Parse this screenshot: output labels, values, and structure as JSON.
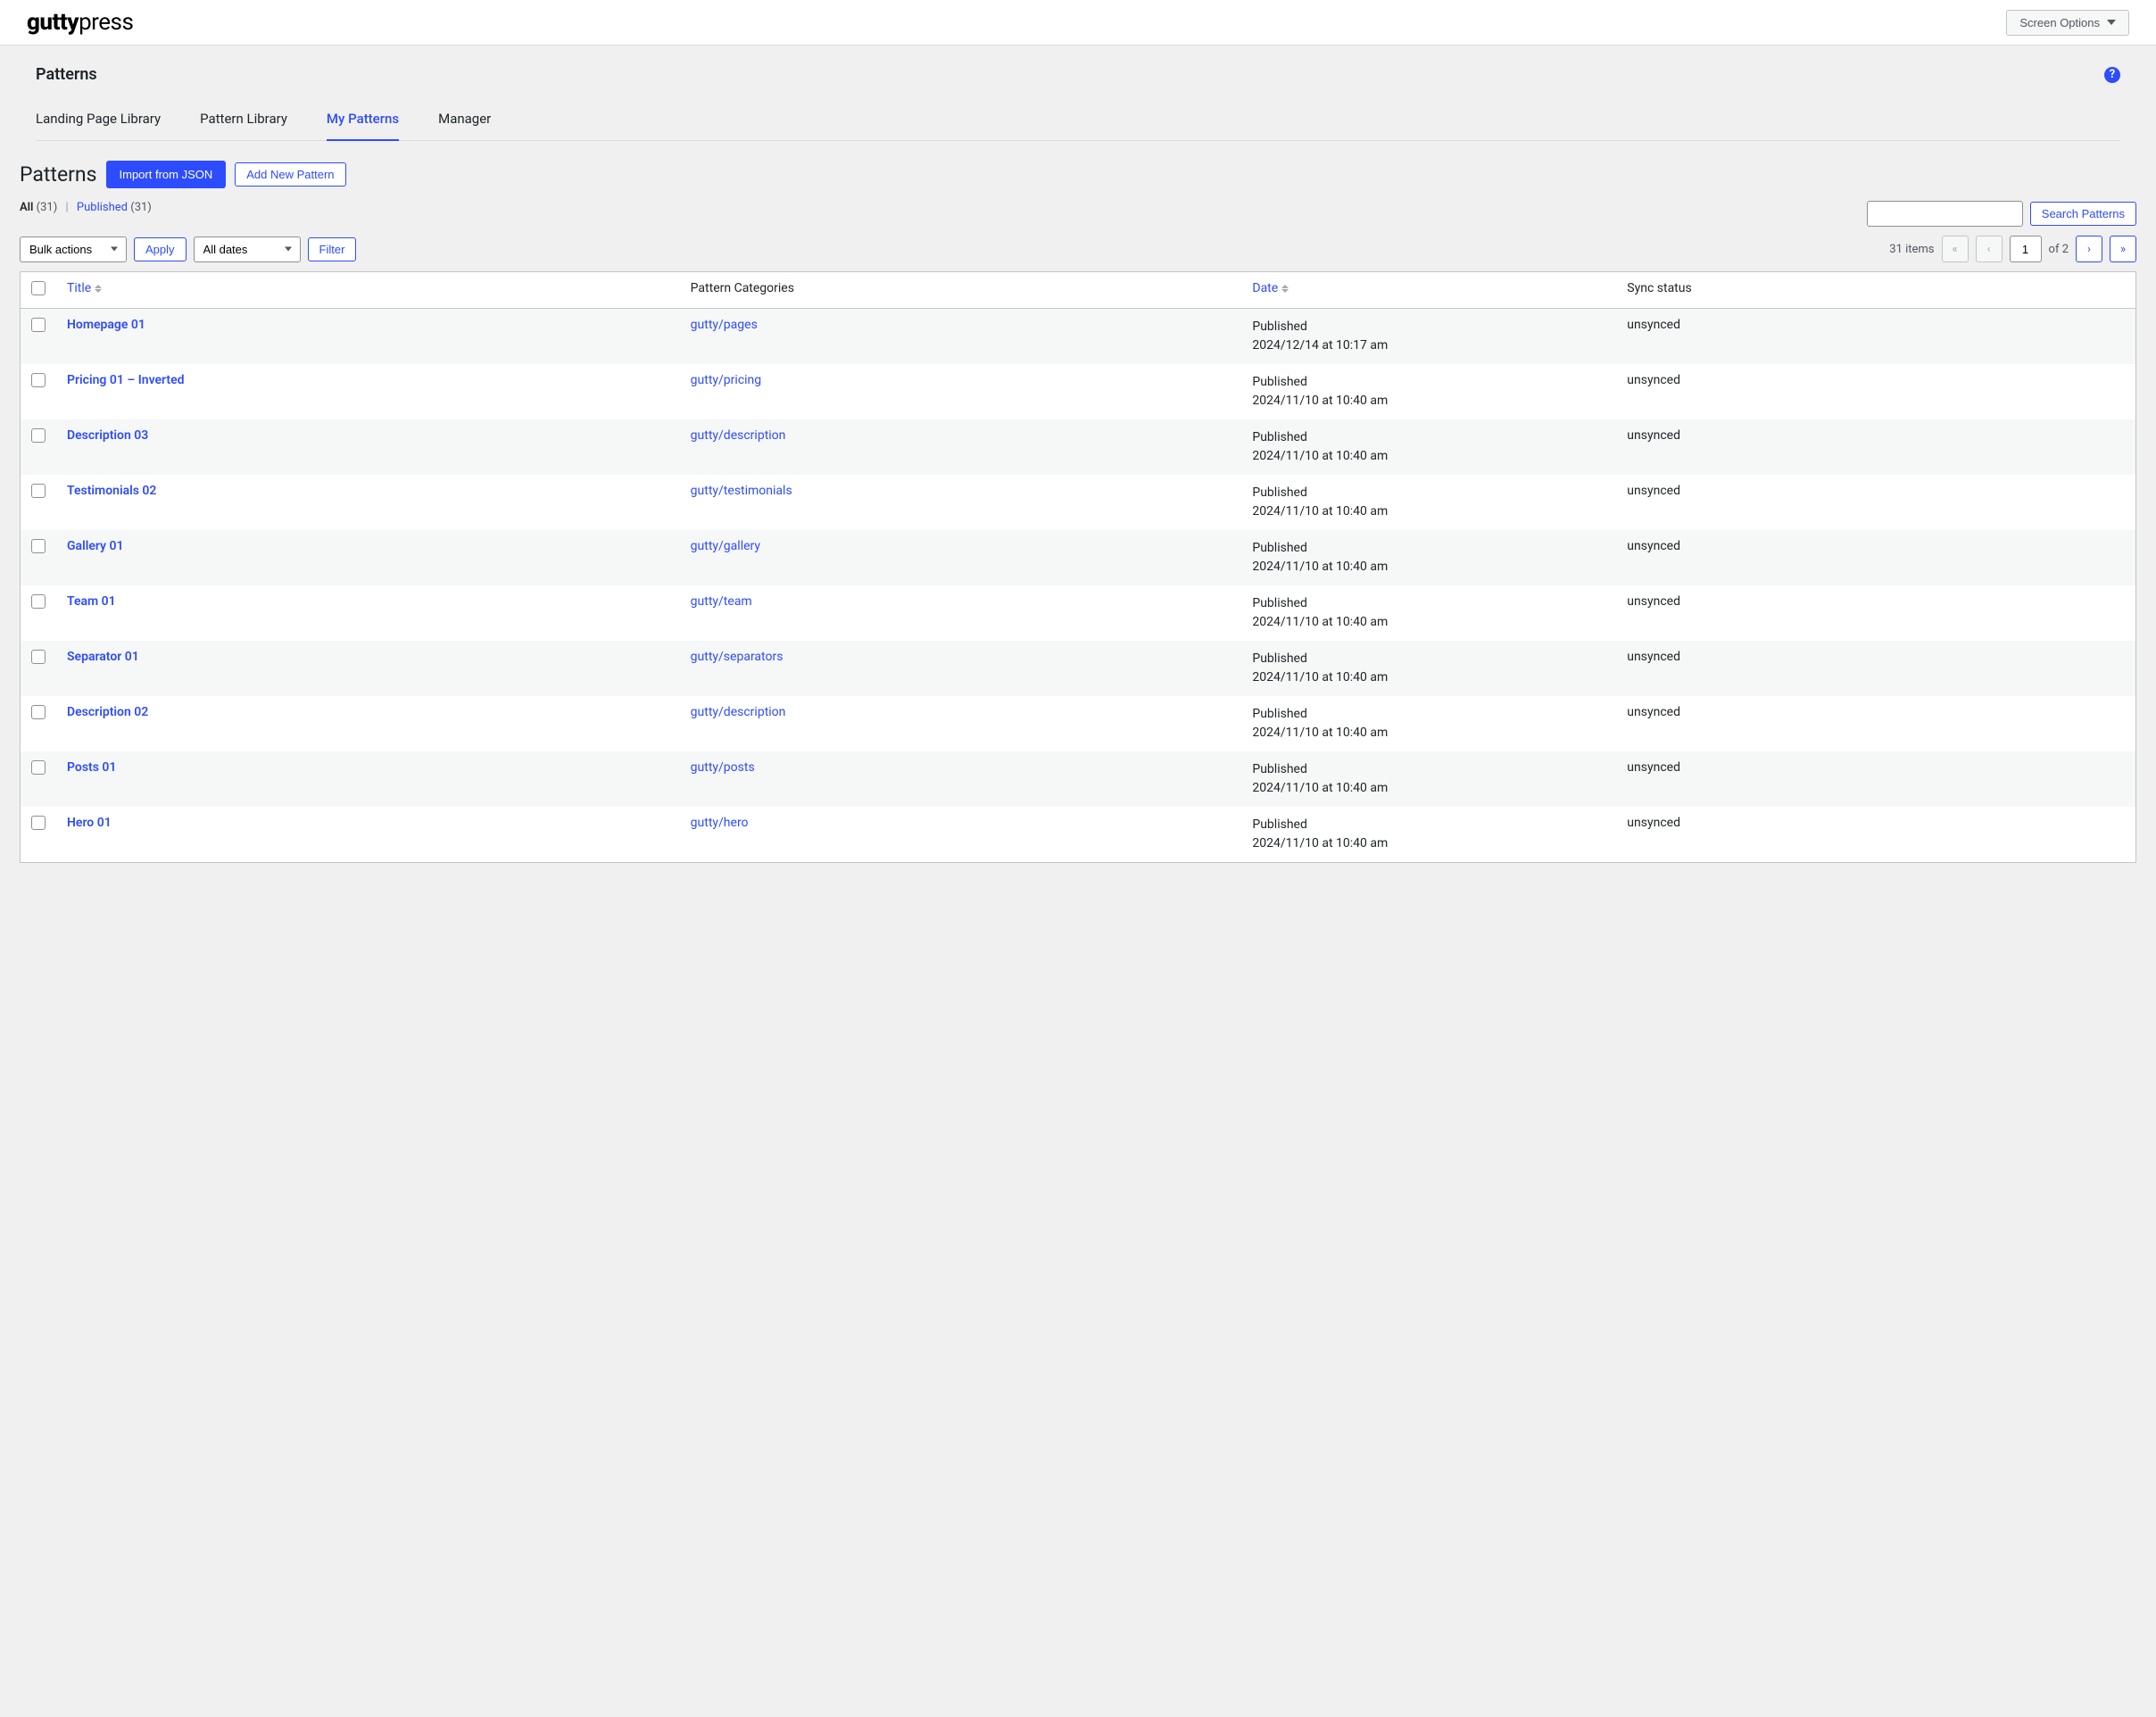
{
  "brand": {
    "bold": "gutty",
    "light": "press"
  },
  "screen_options": {
    "label": "Screen Options"
  },
  "section": {
    "title": "Patterns"
  },
  "help": {
    "symbol": "?"
  },
  "tabs": [
    {
      "label": "Landing Page Library",
      "active": false
    },
    {
      "label": "Pattern Library",
      "active": false
    },
    {
      "label": "My Patterns",
      "active": true
    },
    {
      "label": "Manager",
      "active": false
    }
  ],
  "page": {
    "heading": "Patterns"
  },
  "actions": {
    "import_json": "Import from JSON",
    "add_new": "Add New Pattern"
  },
  "filters_links": {
    "all_label": "All",
    "all_count": "(31)",
    "published_label": "Published",
    "published_count": "(31)"
  },
  "search": {
    "placeholder": "",
    "button": "Search Patterns"
  },
  "bulk": {
    "actions_label": "Bulk actions",
    "apply": "Apply",
    "dates_label": "All dates",
    "filter": "Filter"
  },
  "pagination": {
    "items_text": "31 items",
    "first": "«",
    "prev": "‹",
    "current": "1",
    "of_text": "of 2",
    "next": "›",
    "last": "»"
  },
  "columns": {
    "title": "Title",
    "categories": "Pattern Categories",
    "date": "Date",
    "sync": "Sync status"
  },
  "rows": [
    {
      "title": "Homepage 01",
      "category": "gutty/pages",
      "status": "Published",
      "date": "2024/12/14 at 10:17 am",
      "sync": "unsynced"
    },
    {
      "title": "Pricing 01 – Inverted",
      "category": "gutty/pricing",
      "status": "Published",
      "date": "2024/11/10 at 10:40 am",
      "sync": "unsynced"
    },
    {
      "title": "Description 03",
      "category": "gutty/description",
      "status": "Published",
      "date": "2024/11/10 at 10:40 am",
      "sync": "unsynced"
    },
    {
      "title": "Testimonials 02",
      "category": "gutty/testimonials",
      "status": "Published",
      "date": "2024/11/10 at 10:40 am",
      "sync": "unsynced"
    },
    {
      "title": "Gallery 01",
      "category": "gutty/gallery",
      "status": "Published",
      "date": "2024/11/10 at 10:40 am",
      "sync": "unsynced"
    },
    {
      "title": "Team 01",
      "category": "gutty/team",
      "status": "Published",
      "date": "2024/11/10 at 10:40 am",
      "sync": "unsynced"
    },
    {
      "title": "Separator 01",
      "category": "gutty/separators",
      "status": "Published",
      "date": "2024/11/10 at 10:40 am",
      "sync": "unsynced"
    },
    {
      "title": "Description 02",
      "category": "gutty/description",
      "status": "Published",
      "date": "2024/11/10 at 10:40 am",
      "sync": "unsynced"
    },
    {
      "title": "Posts 01",
      "category": "gutty/posts",
      "status": "Published",
      "date": "2024/11/10 at 10:40 am",
      "sync": "unsynced"
    },
    {
      "title": "Hero 01",
      "category": "gutty/hero",
      "status": "Published",
      "date": "2024/11/10 at 10:40 am",
      "sync": "unsynced"
    }
  ]
}
